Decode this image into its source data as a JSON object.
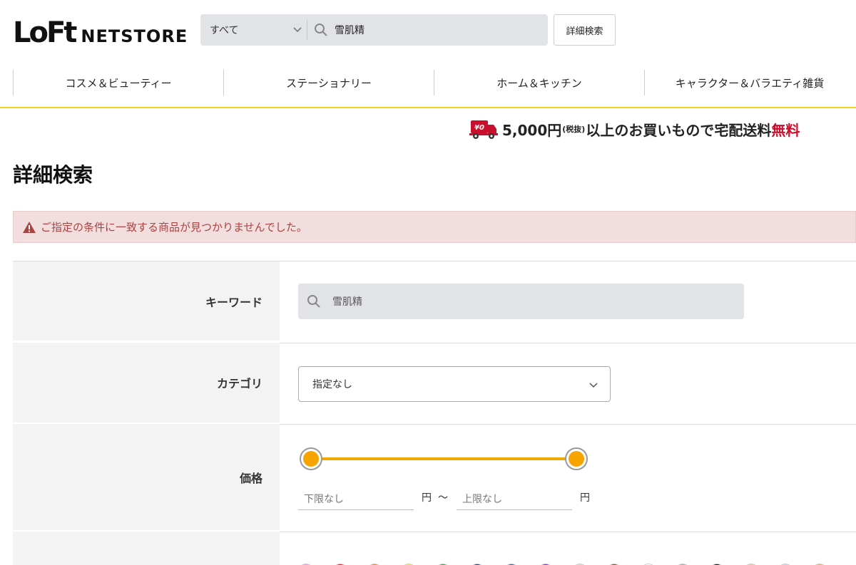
{
  "header": {
    "logo_loft": "LoFt",
    "logo_netstore": "NETSTORE",
    "search_scope": "すべて",
    "search_query": "雪肌精",
    "detail_search_button": "詳細検索"
  },
  "nav": {
    "items": [
      {
        "label": "コスメ＆ビューティー"
      },
      {
        "label": "ステーショナリー"
      },
      {
        "label": "ホーム＆キッチン"
      },
      {
        "label": "キャラクター＆バラエティ雑貨"
      }
    ]
  },
  "shipping": {
    "truck_badge": "¥0",
    "amount": "5,000円",
    "tax": "(税抜)",
    "text": "以上のお買いもので宅配送料",
    "free": "無料"
  },
  "page": {
    "title": "詳細検索"
  },
  "alert": {
    "message": "ご指定の条件に一致する商品が見つかりませんでした。"
  },
  "form": {
    "keyword": {
      "label": "キーワード",
      "value": "雪肌精"
    },
    "category": {
      "label": "カテゴリ",
      "selected": "指定なし"
    },
    "price": {
      "label": "価格",
      "min_placeholder": "下限なし",
      "max_placeholder": "上限なし",
      "unit": "円",
      "separator": "〜",
      "range_fraction": [
        0,
        1
      ]
    },
    "color": {
      "swatches": [
        "#e89ee0",
        "#d8232a",
        "#e9853a",
        "#f2e84a",
        "#3f9e4a",
        "#1f3a73",
        "#3a5a8c",
        "#7b2fbf",
        "#d9dccf",
        "#7a5230",
        "#ffffff",
        "#aaaaaa",
        "#111111",
        "#e6c8a8",
        "#c8d8e8",
        "#e8b060"
      ]
    }
  },
  "colors": {
    "accent_yellow": "#f5d31a",
    "slider_orange": "#f7a400",
    "alert_bg": "#f2dede",
    "alert_text": "#a94442",
    "free_red": "#c8102e"
  }
}
